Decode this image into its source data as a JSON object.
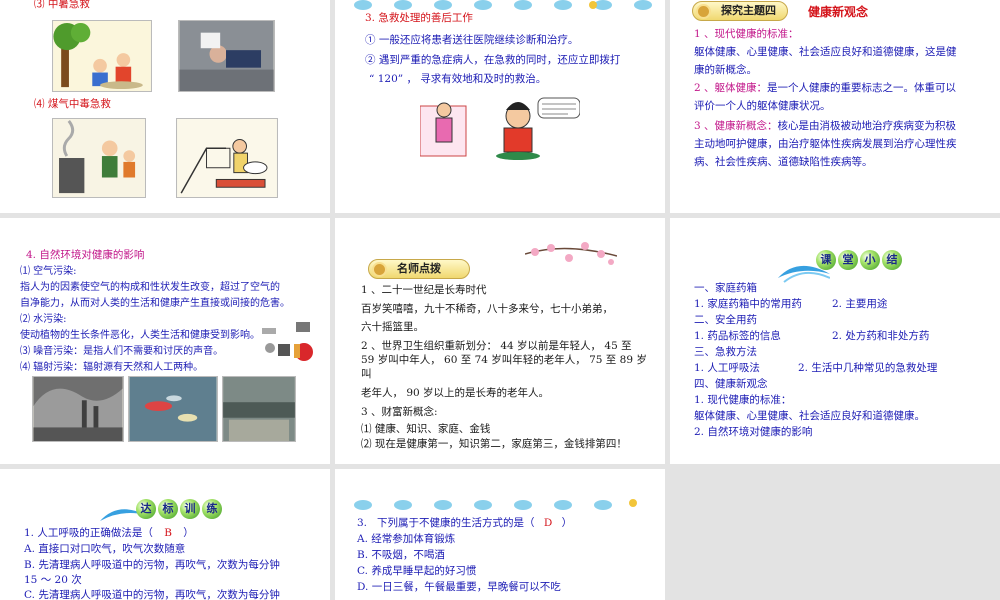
{
  "slide1": {
    "heading_heat": "⑶ 中暑急救",
    "heading_gas": "⑷ 煤气中毒急救"
  },
  "slide2": {
    "heading": "3. 急救处理的善后工作",
    "line1": "① 一般还应将患者送往医院继续诊断和治疗。",
    "line2": "② 遇到严重的急症病人，在急救的同时，还应立即拨打",
    "line3": "“ 120” ， 寻求有效地和及时的救治。"
  },
  "slide3": {
    "badge": "探究主题四",
    "title": "健康新观念",
    "p1_head": "1 、现代健康的标准：",
    "p1_body1": "躯体健康、心里健康、社会适应良好和道德健康，这是健",
    "p1_body2": "康的新概念。",
    "p2_head": "2 、躯体健康：",
    "p2_body1": "是一个人健康的重要标志之一。体重可以",
    "p2_body2": "评价一个人的躯体健康状况。",
    "p3_head": "3 、健康新概念：",
    "p3_body1": "核心是由消极被动地治疗疾病变为积极",
    "p3_body2": "主动地呵护健康，由治疗躯体性疾病发展到治疗心理性疾",
    "p3_body3": "病、社会性疾病、道德缺陷性疾病等。"
  },
  "slide4": {
    "heading": "4. 自然环境对健康的影响",
    "l1": "⑴ 空气污染:",
    "l2": "指人为的因素使空气的构成和性状发生改变，超过了空气的",
    "l3": "自净能力，从而对人类的生活和健康产生直接或间接的危害。",
    "l4": "⑵ 水污染:",
    "l5": "使动植物的生长条件恶化，人类生活和健康受到影响。",
    "l6": "⑶ 噪音污染：是指人们不需要和讨厌的声音。",
    "l7": "⑷ 辐射污染：辐射源有天然和人工两种。"
  },
  "slide5": {
    "badge": "名师点拨",
    "l1": "1 、二十一世纪是长寿时代",
    "l2": "百岁笑嘻嘻，九十不稀奇，八十多来兮，七十小弟弟，",
    "l3": "六十摇篮里。",
    "l4": "2 、世界卫生组织重新划分： 44 岁以前是年轻人， 45 至",
    "l5": "59 岁叫中年人， 60 至 74 岁叫年轻的老年人， 75 至 89 岁",
    "l6": "叫",
    "l7": "老年人， 90 岁以上的是长寿的老年人。",
    "l8": "3 、财富新概念:",
    "l9": "⑴ 健康、知识、家庭、金钱",
    "l10": "⑵ 现在是健康第一，知识第二，家庭第三，金钱排第四！"
  },
  "slide6": {
    "bubbles": [
      "课",
      "堂",
      "小",
      "结"
    ],
    "l1": "一、家庭药箱",
    "l2a": "1. 家庭药箱中的常用药",
    "l2b": "2. 主要用途",
    "l3": "二、安全用药",
    "l4a": "1. 药品标签的信息",
    "l4b": "2. 处方药和非处方药",
    "l5": "三、急救方法",
    "l6a": "1. 人工呼吸法",
    "l6b": "2. 生活中几种常见的急救处理",
    "l7": "四、健康新观念",
    "l8": "1. 现代健康的标准：",
    "l9": "躯体健康、心里健康、社会适应良好和道德健康。",
    "l10": "2. 自然环境对健康的影响"
  },
  "slide7": {
    "bubbles": [
      "达",
      "标",
      "训",
      "练"
    ],
    "q1": "1. 人工呼吸的正确做法是（",
    "q1_answer": "B",
    "q1_close": "）",
    "a": "A. 直接口对口吹气，吹气次数随意",
    "b1": "B. 先清理病人呼吸道中的污物，再吹气，次数为每分钟",
    "b2": "15 ～ 20 次",
    "c": "C. 先清理病人呼吸道中的污物，再吹气，次数为每分钟"
  },
  "slide8": {
    "q3": "3.   下列属于不健康的生活方式的是（",
    "q3_answer": "D",
    "q3_close": "）",
    "a": "A. 经常参加体育锻炼",
    "b": "B. 不吸烟，不喝酒",
    "c": "C. 养成早睡早起的好习惯",
    "d": "D. 一日三餐，午餐最重要，早晚餐可以不吃"
  },
  "colors": {
    "heading_red": "#d4141b",
    "highlight_magenta": "#c2178a",
    "body_blue": "#1c1cb4",
    "background_gray": "#e3e3e3"
  }
}
